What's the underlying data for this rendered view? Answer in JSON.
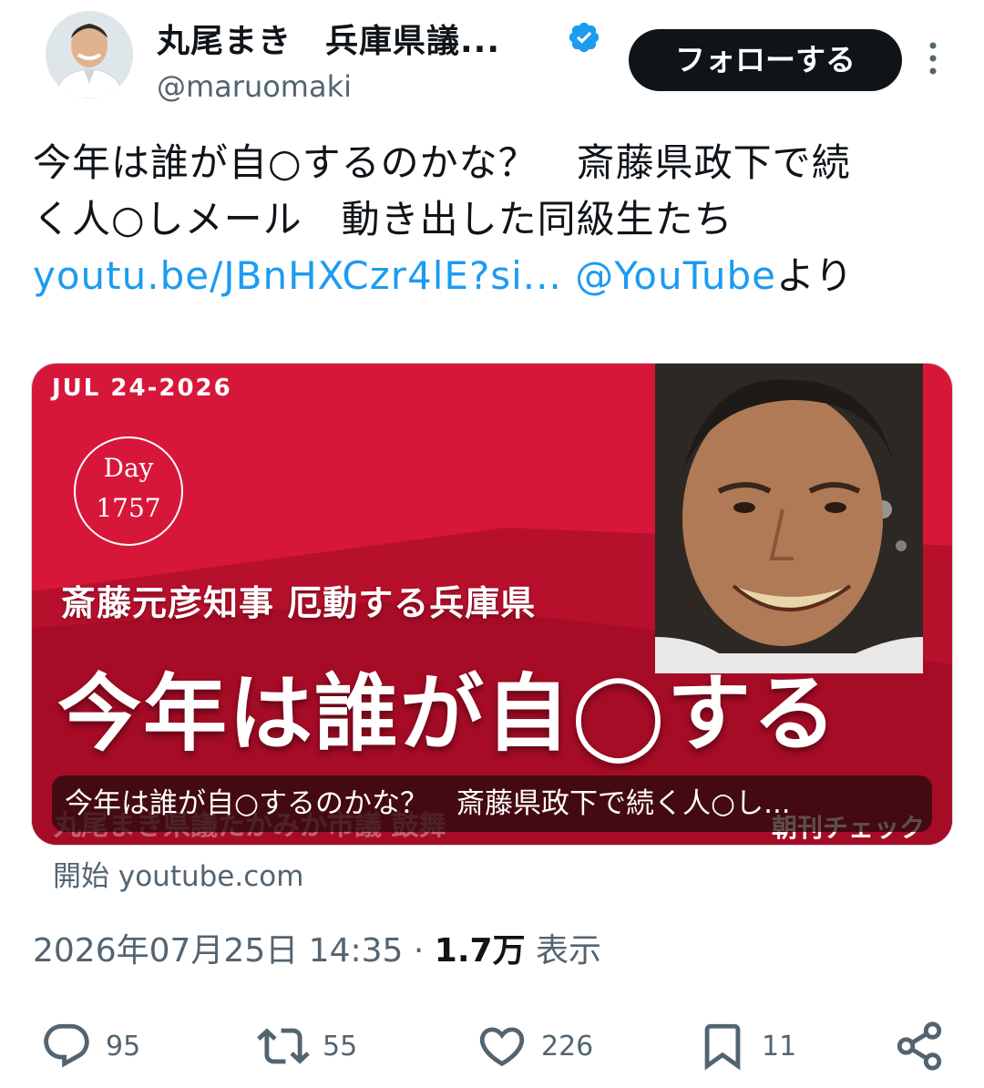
{
  "header": {
    "display_name": "丸尾まき　兵庫県議...",
    "handle": "@maruomaki",
    "follow_label": "フォローする"
  },
  "tweet": {
    "line1": "今年は誰が自○するのかな？　斎藤県政下で続",
    "line2": "く人○しメール　動き出した同級生たち",
    "link1": "youtu.be/JBnHXCzr4lE?si...",
    "link2": "@YouTube",
    "suffix": "より"
  },
  "card": {
    "date": "JUL 24-2026",
    "day_label": "Day",
    "day_number": "1757",
    "subheading": "斎藤元彦知事 厄動する兵庫県",
    "headline": "今年は誰が自◯する",
    "caption": "今年は誰が自○するのかな？　斎藤県政下で続く人○し...",
    "ghost_text": "丸尾まき県議たかみか市議 鼓舞",
    "brand": "朝刊チェック",
    "source": "開始 youtube.com"
  },
  "meta": {
    "timestamp": "2026年07月25日 14:35",
    "separator": "·",
    "views_count": "1.7万",
    "views_label": "表示"
  },
  "actions": {
    "replies": "95",
    "reposts": "55",
    "likes": "226",
    "bookmarks": "11"
  },
  "colors": {
    "card_red": "#d7173a",
    "link_blue": "#1d9bf0",
    "verified_blue": "#1d9bf0",
    "muted": "#536471"
  }
}
